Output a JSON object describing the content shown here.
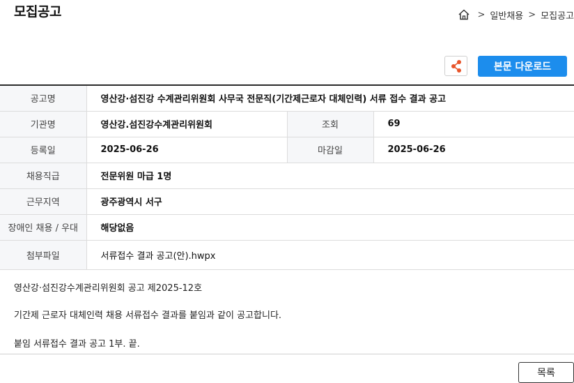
{
  "page": {
    "title": "모집공고"
  },
  "breadcrumb": {
    "items": [
      "일반채용",
      "모집공고"
    ],
    "separator": ">"
  },
  "actions": {
    "download_label": "본문 다운로드",
    "list_label": "목록"
  },
  "icons": {
    "home": "home-icon",
    "share": "share-icon"
  },
  "colors": {
    "accent": "#1c8ded",
    "share_icon": "#e8542a"
  },
  "details": {
    "title_label": "공고명",
    "title_value": "영산강·섬진강 수계관리위원회 사무국 전문직(기간제근로자 대체인력) 서류 접수 결과 공고",
    "org_label": "기관명",
    "org_value": "영산강.섬진강수계관리위원회",
    "views_label": "조회",
    "views_value": "69",
    "reg_label": "등록일",
    "reg_value": "2025-06-26",
    "deadline_label": "마감일",
    "deadline_value": "2025-06-26",
    "grade_label": "채용직급",
    "grade_value": "전문위원 마급 1명",
    "region_label": "근무지역",
    "region_value": "광주광역시 서구",
    "pref_label": "장애인 채용 / 우대",
    "pref_value": "해당없음",
    "file_label": "첨부파일",
    "file_value": "서류접수 결과 공고(안).hwpx"
  },
  "content": {
    "line1": "영산강·섬진강수계관리위원회 공고 제2025-12호",
    "line2": "기간제 근로자 대체인력 채용 서류접수 결과를 붙임과 같이 공고합니다.",
    "line3": "붙임  서류접수 결과 공고 1부.  끝."
  }
}
